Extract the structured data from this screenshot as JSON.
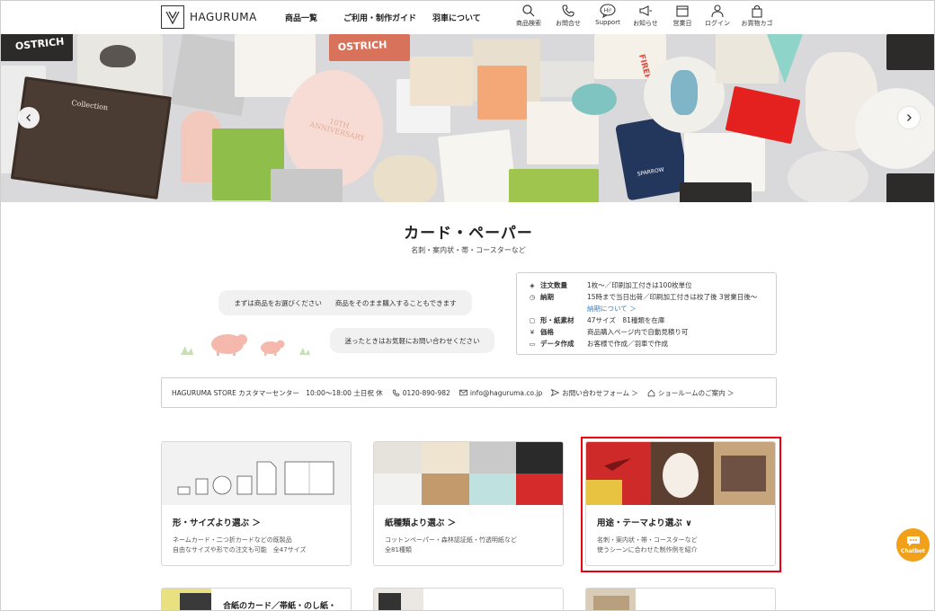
{
  "header": {
    "brand": "HAGURUMA",
    "nav": [
      "商品一覧",
      "ご利用・制作ガイド",
      "羽車について"
    ],
    "icons": [
      {
        "label": "商品検索",
        "icon": "search-icon"
      },
      {
        "label": "お問合せ",
        "icon": "phone-icon"
      },
      {
        "label": "Support",
        "icon": "support-bubble-icon",
        "glyph": "Hi!"
      },
      {
        "label": "お知らせ",
        "icon": "megaphone-icon"
      },
      {
        "label": "営業日",
        "icon": "calendar-icon"
      },
      {
        "label": "ログイン",
        "icon": "user-icon"
      },
      {
        "label": "お買物カゴ",
        "icon": "bag-icon"
      }
    ]
  },
  "hero": {
    "card_text": [
      "OSTRICH",
      "OSTRICH",
      "Collection",
      "10TH ANNIVERSARY",
      "FIREFLY",
      "SPARROW",
      "SPARROW"
    ]
  },
  "page": {
    "title": "カード・ペーパー",
    "subtitle": "名刺・案内状・帯・コースターなど"
  },
  "bubbles": [
    "まずは商品をお選びください　　商品をそのまま購入することもできます",
    "迷ったときはお気軽にお問い合わせください"
  ],
  "spec": {
    "rows": [
      {
        "icon": "stack-icon",
        "label": "注文数量",
        "value": "1枚〜／印刷加工付きは100枚単位"
      },
      {
        "icon": "clock-icon",
        "label": "納期",
        "value": "15時まで当日出荷／印刷加工付きは校了後 3営業日後〜"
      },
      {
        "icon": "square-icon",
        "label": "形・紙素材",
        "value": "47サイズ　81種類を在庫"
      },
      {
        "icon": "yen-icon",
        "label": "価格",
        "value": "商品購入ページ内で自動見積り可"
      },
      {
        "icon": "monitor-icon",
        "label": "データ作成",
        "value": "お客様で作成／羽車で作成"
      }
    ],
    "link": "納期について ＞"
  },
  "store": {
    "center": "HAGURUMA STORE カスタマーセンター　10:00〜18:00 土日祝 休",
    "phone": "0120-890-982",
    "email": "info@haguruma.co.jp",
    "contact_form": "お問い合わせフォーム ＞",
    "showroom": "ショールームのご案内 ＞"
  },
  "categories": [
    {
      "title": "形・サイズより選ぶ ＞",
      "desc1": "ネームカード・二つ折カードなどの既製品",
      "desc2": "自由なサイズや形での注文も可能　全47サイズ"
    },
    {
      "title": "紙種類より選ぶ ＞",
      "desc1": "コットンペーパー・森林認証紙・竹透明紙など",
      "desc2": "全81種類"
    },
    {
      "title": "用途・テーマより選ぶ ∨",
      "desc1": "名刺・案内状・帯・コースターなど",
      "desc2": "使うシーンに合わせた制作例を紹介"
    }
  ],
  "categories_row2": [
    "合紙のカード／帯紙・のし紙・"
  ],
  "chatbot": {
    "label": "Chatbot"
  },
  "colors": {
    "accent_red": "#e60012",
    "chatbot_orange": "#f0a019",
    "link_blue": "#3b7fc4"
  }
}
